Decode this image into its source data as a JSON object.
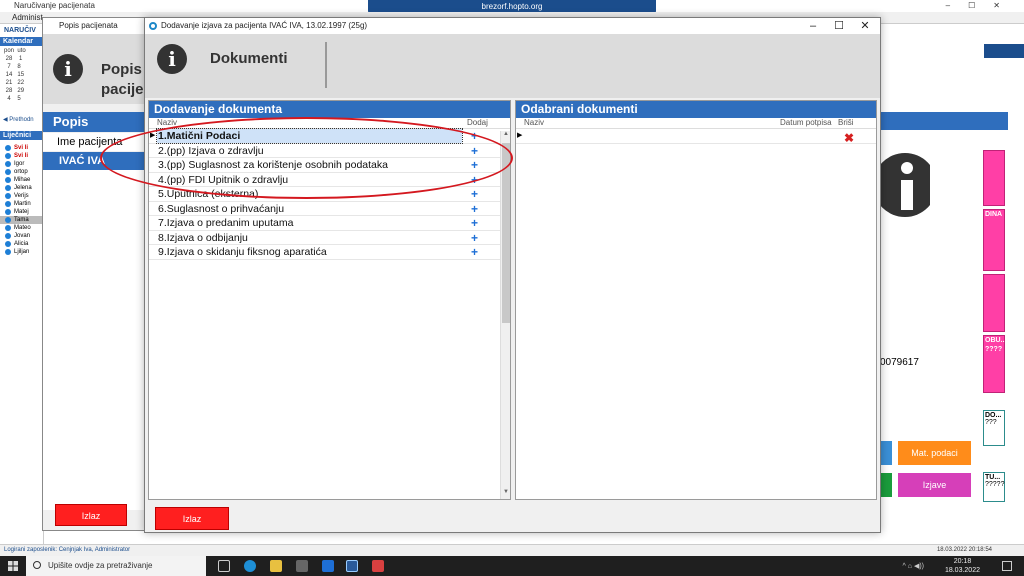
{
  "background": {
    "window_title": "Naručivanje pacijenata",
    "tab_label": "Administ",
    "remote_title": "brezorf.hopto.org",
    "left": {
      "naruc_label": "NARUČIV",
      "calendar_title": "Kalendar",
      "calendar_days": [
        "pon",
        "uto"
      ],
      "calendar_rows": [
        [
          "28",
          "1"
        ],
        [
          "7",
          "8"
        ],
        [
          "14",
          "15"
        ],
        [
          "21",
          "22"
        ],
        [
          "28",
          "29"
        ],
        [
          "4",
          "5"
        ]
      ],
      "prev_label": "Prethodn",
      "lijecnici_title": "Liječnici",
      "doctors": [
        "Svi li",
        "Svi li",
        "Igor",
        "ortop",
        "Mihae",
        "Jelena",
        "Verijs",
        "Martin",
        "Matej",
        "Tama",
        "Mateo",
        "Jovan",
        "Alicia",
        "Ljiljan"
      ]
    },
    "right": {
      "phone_fragment": "0079617",
      "mat_podaci_label": "Mat. podaci",
      "izjave_label": "Izjave",
      "pink_labels": [
        "DINA",
        "OBU...",
        "DO...",
        "TU..."
      ],
      "pink_marks": "????",
      "mini_marks": "???",
      "mini_marks2": "?????"
    },
    "status_text": "Logirani zaposlenik: Cenjnjak Iva, Administrator",
    "status_datetime": "18.03.2022 20:18:54"
  },
  "popis_window": {
    "title": "Popis pacijenata",
    "header_text_1": "Popis",
    "header_text_2": "pacije",
    "section_title": "Popis",
    "column_header": "Ime pacijenta",
    "selected_patient": "IVAĆ IVA",
    "exit_label": "Izlaz"
  },
  "dialog": {
    "title": "Dodavanje izjava za pacijenta IVAĆ IVA, 13.02.1997  (25g)",
    "heading": "Dokumenti",
    "controls": [
      "–",
      "☐",
      "✕"
    ],
    "left_panel": {
      "title": "Dodavanje dokumenta",
      "col_name": "Naziv",
      "col_add": "Dodaj",
      "documents": [
        "1.Matični Podaci",
        "2.(pp) Izjava o zdravlju",
        "3.(pp) Suglasnost za korištenje osobnih podataka",
        "4.(pp) FDI Upitnik o zdravlju",
        "5.Uputnica (eksterna)",
        "6.Suglasnost o prihvaćanju",
        "7.Izjava o predanim uputama",
        "8.Izjava o odbijanju",
        "9.Izjava o skidanju fiksnog aparatića"
      ],
      "add_symbol": "+"
    },
    "right_panel": {
      "title": "Odabrani dokumenti",
      "col_name": "Naziv",
      "col_date": "Datum potpisa",
      "col_delete": "Briši",
      "delete_symbol": "✖"
    },
    "exit_label": "Izlaz"
  },
  "taskbar": {
    "search_placeholder": "Upišite ovdje za pretraživanje",
    "time": "20:18",
    "date": "18.03.2022",
    "tray": "^ ⌂ ◀))"
  },
  "colors": {
    "accent_blue": "#2f6ebd",
    "exit_red": "#ff1f1f",
    "add_blue": "#1e6fd6",
    "delete_red": "#d62020",
    "annotation_red": "#d4181f",
    "pink_card": "#ff3fa6",
    "orange_button": "#ff8c1a"
  }
}
